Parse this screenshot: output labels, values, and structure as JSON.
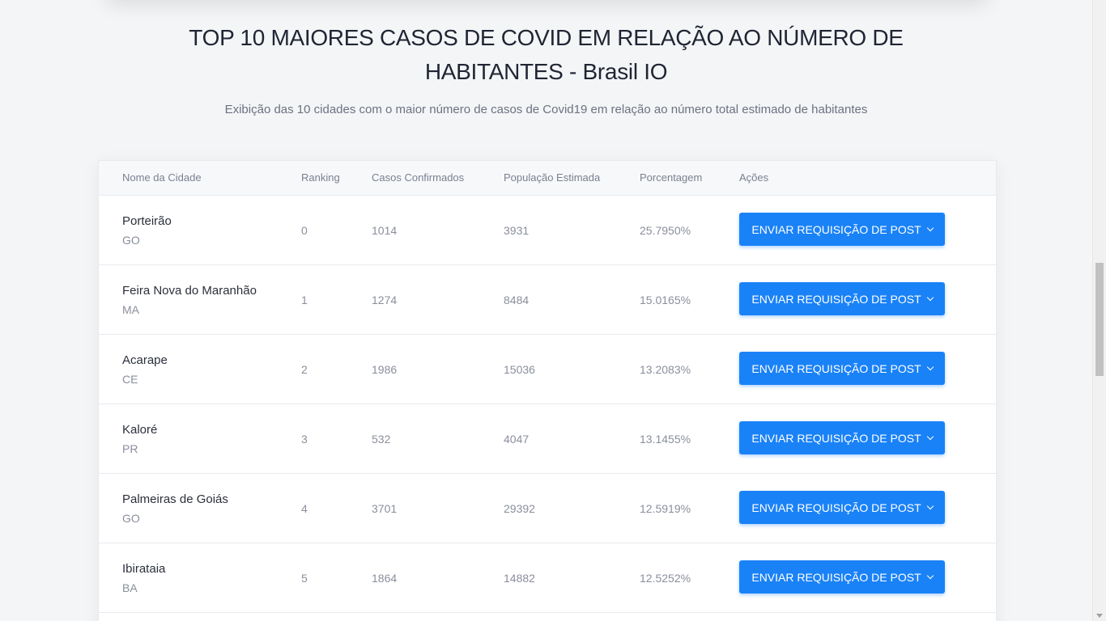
{
  "header": {
    "title": "TOP 10 MAIORES CASOS DE COVID EM RELAÇÃO AO NÚMERO DE HABITANTES - Brasil IO",
    "subtitle": "Exibição das 10 cidades com o maior número de casos de Covid19 em relação ao número total estimado de habitantes"
  },
  "table": {
    "columns": {
      "city": "Nome da Cidade",
      "ranking": "Ranking",
      "cases": "Casos Confirmados",
      "population": "População Estimada",
      "percentage": "Porcentagem",
      "actions": "Ações"
    },
    "rows": [
      {
        "city": "Porteirão",
        "state": "GO",
        "ranking": "0",
        "cases": "1014",
        "population": "3931",
        "percentage": "25.7950%",
        "action": "ENVIAR REQUISIÇÃO DE POST"
      },
      {
        "city": "Feira Nova do Maranhão",
        "state": "MA",
        "ranking": "1",
        "cases": "1274",
        "population": "8484",
        "percentage": "15.0165%",
        "action": "ENVIAR REQUISIÇÃO DE POST"
      },
      {
        "city": "Acarape",
        "state": "CE",
        "ranking": "2",
        "cases": "1986",
        "population": "15036",
        "percentage": "13.2083%",
        "action": "ENVIAR REQUISIÇÃO DE POST"
      },
      {
        "city": "Kaloré",
        "state": "PR",
        "ranking": "3",
        "cases": "532",
        "population": "4047",
        "percentage": "13.1455%",
        "action": "ENVIAR REQUISIÇÃO DE POST"
      },
      {
        "city": "Palmeiras de Goiás",
        "state": "GO",
        "ranking": "4",
        "cases": "3701",
        "population": "29392",
        "percentage": "12.5919%",
        "action": "ENVIAR REQUISIÇÃO DE POST"
      },
      {
        "city": "Ibirataia",
        "state": "BA",
        "ranking": "5",
        "cases": "1864",
        "population": "14882",
        "percentage": "12.5252%",
        "action": "ENVIAR REQUISIÇÃO DE POST"
      }
    ]
  },
  "colors": {
    "accent": "#1a82f7",
    "background": "#f4f5f7"
  },
  "icons": {
    "button_icon": "chevron-down-icon"
  }
}
